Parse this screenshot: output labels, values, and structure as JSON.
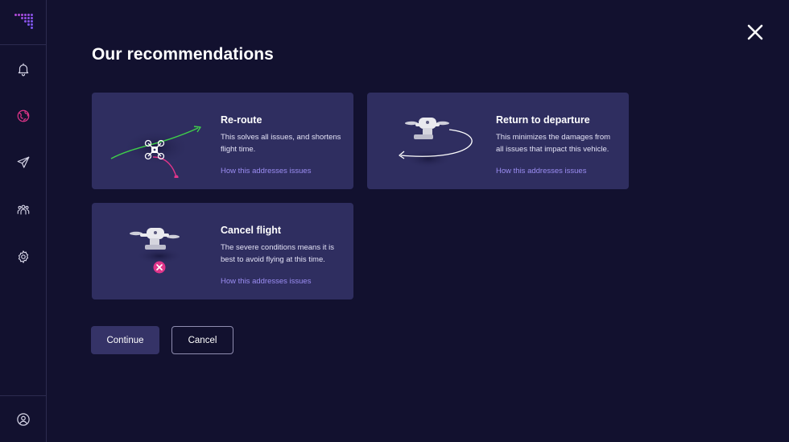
{
  "sidebar": {
    "items": [
      {
        "icon": "bell-icon",
        "active": false
      },
      {
        "icon": "globe-icon",
        "active": true
      },
      {
        "icon": "send-icon",
        "active": false
      },
      {
        "icon": "team-icon",
        "active": false
      },
      {
        "icon": "settings-icon",
        "active": false
      }
    ],
    "bottom_icon": "user-avatar-icon",
    "active_color": "#e0358a",
    "icon_color": "#d7d6e8"
  },
  "header": {
    "title": "Our recommendations",
    "close_icon": "close-icon"
  },
  "recommendations": [
    {
      "title": "Re-route",
      "description": "This solves all issues, and shortens flight time.",
      "link": "How this addresses issues"
    },
    {
      "title": "Return to departure",
      "description": "This minimizes the damages from all issues that impact this vehicle.",
      "link": "How this addresses issues"
    },
    {
      "title": "Cancel flight",
      "description": "The severe conditions means it is best to avoid flying at this time.",
      "link": "How this addresses issues"
    }
  ],
  "actions": {
    "continue_label": "Continue",
    "cancel_label": "Cancel"
  },
  "colors": {
    "background": "#12112f",
    "card": "#2f2e60",
    "link": "#9b8df2",
    "green_path": "#3fcf4a",
    "pink_path": "#e0358a"
  }
}
